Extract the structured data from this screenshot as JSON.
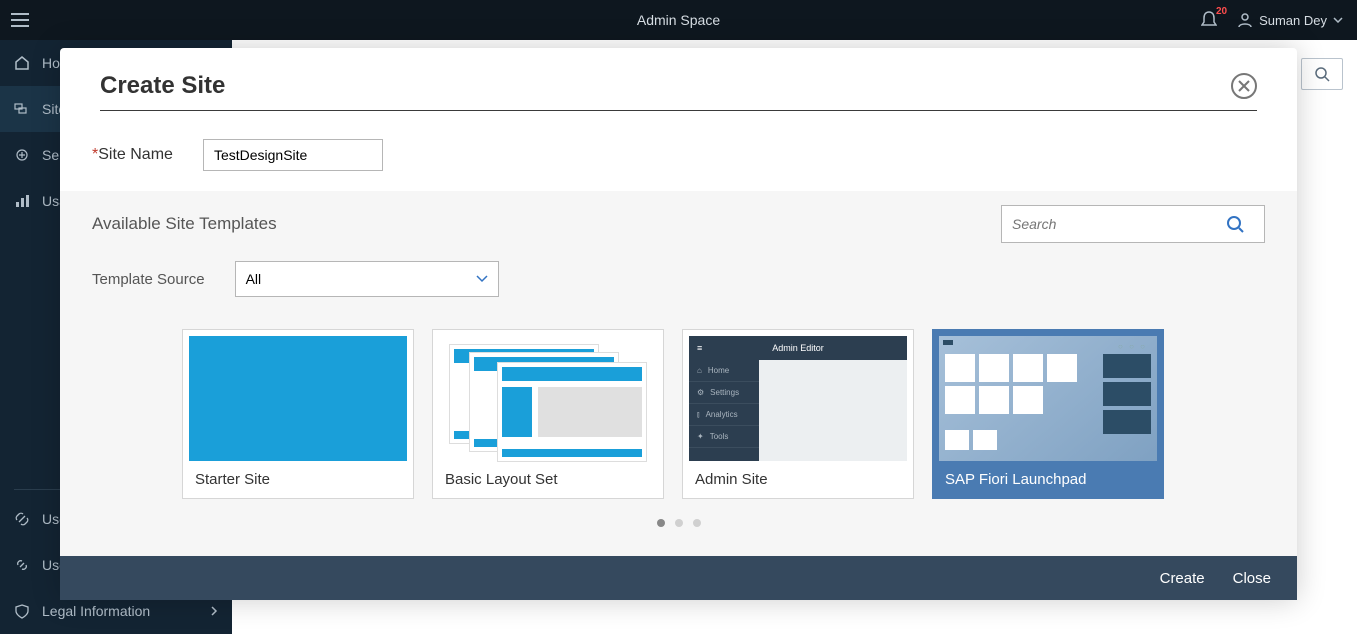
{
  "header": {
    "title": "Admin Space",
    "notification_count": "20",
    "user_name": "Suman Dey"
  },
  "sidebar": {
    "items": [
      "Home",
      "Sites",
      "Services",
      "Usage"
    ],
    "bottom_items": [
      "Useful Links",
      "User Guide",
      "Legal Information"
    ]
  },
  "dialog": {
    "title": "Create Site",
    "site_name_label": "Site Name",
    "site_name_value": "TestDesignSite",
    "templates_heading": "Available Site Templates",
    "search_placeholder": "Search",
    "template_source_label": "Template Source",
    "template_source_value": "All",
    "templates": [
      {
        "name": "Starter Site"
      },
      {
        "name": "Basic Layout Set"
      },
      {
        "name": "Admin Site"
      },
      {
        "name": "SAP Fiori Launchpad"
      }
    ],
    "footer": {
      "create": "Create",
      "close": "Close"
    }
  },
  "admin_preview": {
    "title": "Admin Editor",
    "items": [
      "Home",
      "Settings",
      "Analytics",
      "Tools"
    ]
  }
}
